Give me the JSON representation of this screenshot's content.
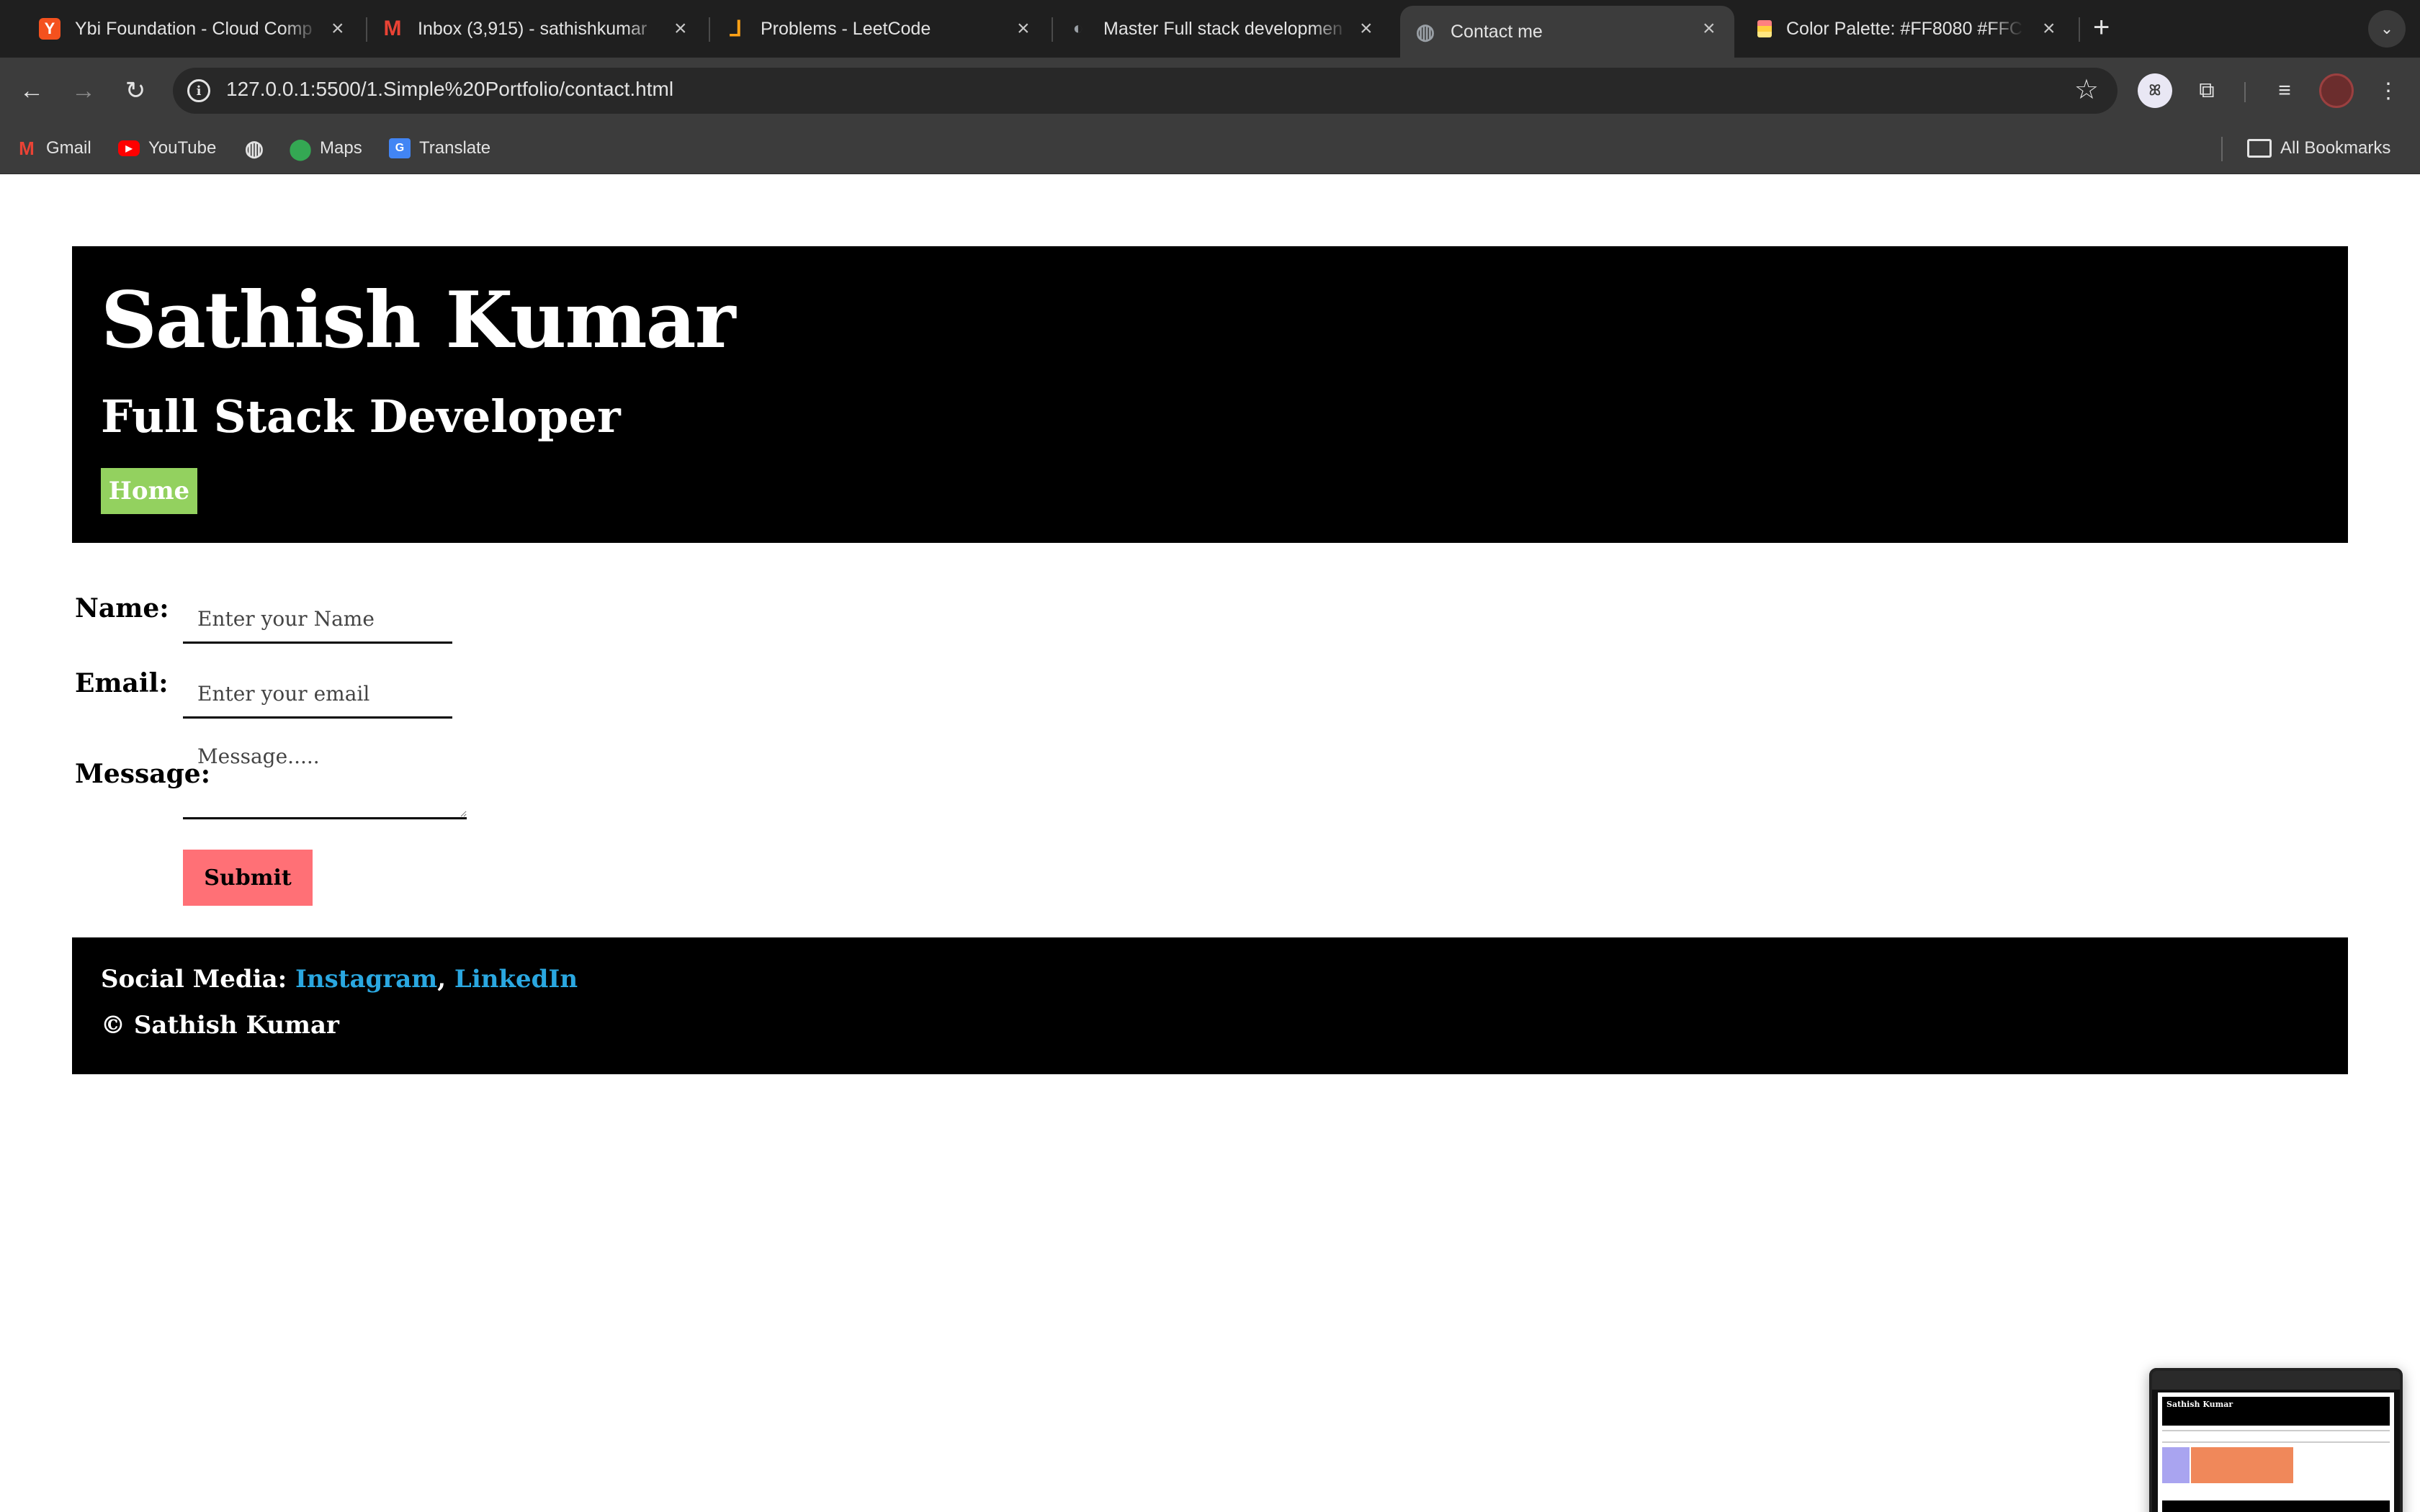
{
  "browser": {
    "tabs": [
      {
        "title": "Ybi Foundation - Cloud Comp",
        "favicon": "ybi-icon",
        "color": "#f4511e"
      },
      {
        "title": "Inbox (3,915) - sathishkumar",
        "favicon": "gmail-icon",
        "color": "#ea4335"
      },
      {
        "title": "Problems - LeetCode",
        "favicon": "leetcode-icon",
        "color": "#ffa116"
      },
      {
        "title": "Master Full stack developmen",
        "favicon": "course-icon",
        "color": "#9aa0a6"
      },
      {
        "title": "Contact me",
        "favicon": "globe-icon",
        "color": "#9aa0a6"
      },
      {
        "title": "Color Palette: #FF8080 #FFC",
        "favicon": "palette-icon",
        "color": "#ffcf40"
      }
    ],
    "active_tab_index": 4,
    "url": "127.0.0.1:5500/1.Simple%20Portfolio/contact.html",
    "bookmarks": [
      {
        "label": "Gmail",
        "icon": "gmail-icon"
      },
      {
        "label": "YouTube",
        "icon": "youtube-icon"
      },
      {
        "label": "",
        "icon": "globe-icon"
      },
      {
        "label": "Maps",
        "icon": "maps-icon"
      },
      {
        "label": "Translate",
        "icon": "translate-icon"
      }
    ],
    "all_bookmarks_label": "All Bookmarks"
  },
  "header": {
    "name": "Sathish Kumar",
    "role": "Full Stack Developer",
    "nav_home": "Home",
    "bg_color": "#000000",
    "home_color": "#93d15f"
  },
  "form": {
    "name_label": "Name:",
    "name_placeholder": "Enter your Name",
    "email_label": "Email:",
    "email_placeholder": "Enter your email",
    "message_label": "Message:",
    "message_placeholder": "Message.....",
    "submit_label": "Submit",
    "submit_color": "#ff7076"
  },
  "footer": {
    "social_prefix": "Social Media:",
    "instagram": "Instagram",
    "separator": ",",
    "linkedin": "LinkedIn",
    "copyright": "© Sathish Kumar",
    "link_color": "#2aa7e0"
  },
  "thumbnail": {
    "title": "Sathish Kumar"
  }
}
